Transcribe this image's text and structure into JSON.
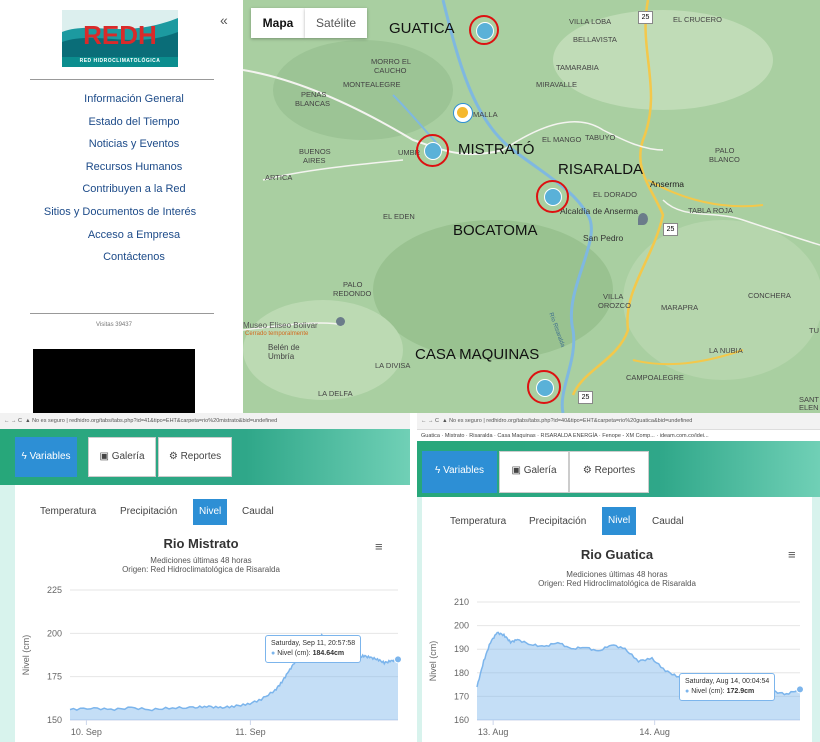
{
  "sidebar": {
    "logo_text": "REDH",
    "logo_subtitle": "RED HIDROCLIMATOLÓGICA",
    "collapse_icon": "«",
    "nav": [
      "Información General",
      "Estado del Tiempo",
      "Noticias y Eventos",
      "Recursos Humanos",
      "Contribuyen a la Red",
      "Sitios y Documentos de Interés",
      "Acceso a Empresa",
      "Contáctenos"
    ],
    "visits": "Visitas 39437"
  },
  "map": {
    "tabs": [
      "Mapa",
      "Satélite"
    ],
    "towns": [
      "MORRO EL",
      "CAUCHO",
      "MONTEALEGRE",
      "PENAS",
      "BLANCAS",
      "BUENOS",
      "AIRES",
      "ARTICA",
      "EL EDEN",
      "PALO",
      "REDONDO",
      "Museo Eliseo Bolivar",
      "Cerrado temporalmente",
      "Belén de",
      "Umbría",
      "LA DIVISA",
      "LA DELFA",
      "VILLA LOBA",
      "EL CRUCERO",
      "BELLAVISTA",
      "TAMARABIA",
      "MIRAVALLE",
      "MALLA",
      "EL MANGO",
      "TABUYO",
      "PALO",
      "BLANCO",
      "EL DORADO",
      "Anserma",
      "Alcaldía de Anserma",
      "TABLA ROJA",
      "San Pedro",
      "VILLA",
      "OROZCO",
      "MARAPRA",
      "CONCHERA",
      "LA NUBIA",
      "CAMPOALEGRE",
      "SANT",
      "ELEN",
      "TU",
      "UMBR",
      "Río Risaralda"
    ],
    "road_numbers": [
      "25",
      "25",
      "25"
    ],
    "stations": [
      "GUATICA",
      "MISTRATÓ",
      "RISARALDA",
      "BOCATOMA",
      "CASA MAQUINAS"
    ]
  },
  "left_panel": {
    "url": "No es seguro | redhidro.org/tabs/tabs.php?id=41&tipo=EHT&carpeta=rio%20mistrato&bid=undefined",
    "buttons": [
      "Variables",
      "Galería",
      "Reportes"
    ],
    "subtabs": [
      "Temperatura",
      "Precipitación",
      "Nivel",
      "Caudal"
    ],
    "title": "Rio Mistrato",
    "subtitle1": "Mediciones últimas 48 horas",
    "subtitle2": "Origen: Red Hidroclimatológica de Risaralda",
    "tooltip_date": "Saturday, Sep 11, 20:57:58",
    "tooltip_value_label": "Nivel (cm):",
    "tooltip_value": "184.64cm"
  },
  "right_panel": {
    "url": "No es seguro | redhidro.org/tabs/tabs.php?id=40&tipo=EHT&carpeta=rio%20guatica&bid=undefined",
    "bookmarks": "Guatica · Mistrato · Risaralda · Casa Maquinas · RISARALDA ENERGÍA · Fenope - XM Comp... · ideam.com.co/idei...",
    "buttons": [
      "Variables",
      "Galería",
      "Reportes"
    ],
    "subtabs": [
      "Temperatura",
      "Precipitación",
      "Nivel",
      "Caudal"
    ],
    "title": "Rio Guatica",
    "subtitle1": "Mediciones últimas 48 horas",
    "subtitle2": "Origen: Red Hidroclimatológica de Risaralda",
    "tooltip_date": "Saturday, Aug 14, 00:04:54",
    "tooltip_value_label": "Nivel (cm):",
    "tooltip_value": "172.9cm"
  },
  "chart_data": [
    {
      "type": "area",
      "title": "Rio Mistrato",
      "ylabel": "Nivel (cm)",
      "ylim": [
        150,
        225
      ],
      "yticks": [
        "150",
        "175",
        "200",
        "225"
      ],
      "xticks": [
        "10. Sep",
        "11. Sep"
      ],
      "x_hours": [
        0,
        3,
        6,
        9,
        12,
        15,
        18,
        20,
        22,
        24,
        26,
        28,
        30,
        31,
        32,
        33,
        34,
        35,
        36,
        37,
        38,
        39,
        40,
        41,
        42,
        43,
        44,
        45,
        46,
        47,
        48
      ],
      "values": [
        156,
        157,
        156,
        157,
        156,
        157,
        157,
        158,
        157,
        158,
        159,
        162,
        167,
        172,
        178,
        184,
        189,
        195,
        197,
        199,
        194,
        190,
        192,
        189,
        186,
        187,
        186,
        185,
        183,
        184,
        185
      ]
    },
    {
      "type": "area",
      "title": "Rio Guatica",
      "ylabel": "Nivel (cm)",
      "ylim": [
        160,
        210
      ],
      "yticks": [
        "160",
        "170",
        "180",
        "190",
        "200",
        "210"
      ],
      "xticks": [
        "13. Aug",
        "14. Aug"
      ],
      "x_hours": [
        0,
        1,
        2,
        3,
        4,
        5,
        6,
        8,
        10,
        12,
        14,
        16,
        18,
        20,
        22,
        24,
        26,
        28,
        30,
        32,
        34,
        36,
        38,
        40,
        42,
        44,
        46,
        48
      ],
      "values": [
        174,
        185,
        193,
        197,
        196,
        193,
        194,
        192,
        191,
        193,
        190,
        191,
        189,
        192,
        190,
        185,
        186,
        181,
        178,
        175,
        174,
        173,
        172,
        171,
        172,
        172,
        171,
        173
      ]
    }
  ]
}
